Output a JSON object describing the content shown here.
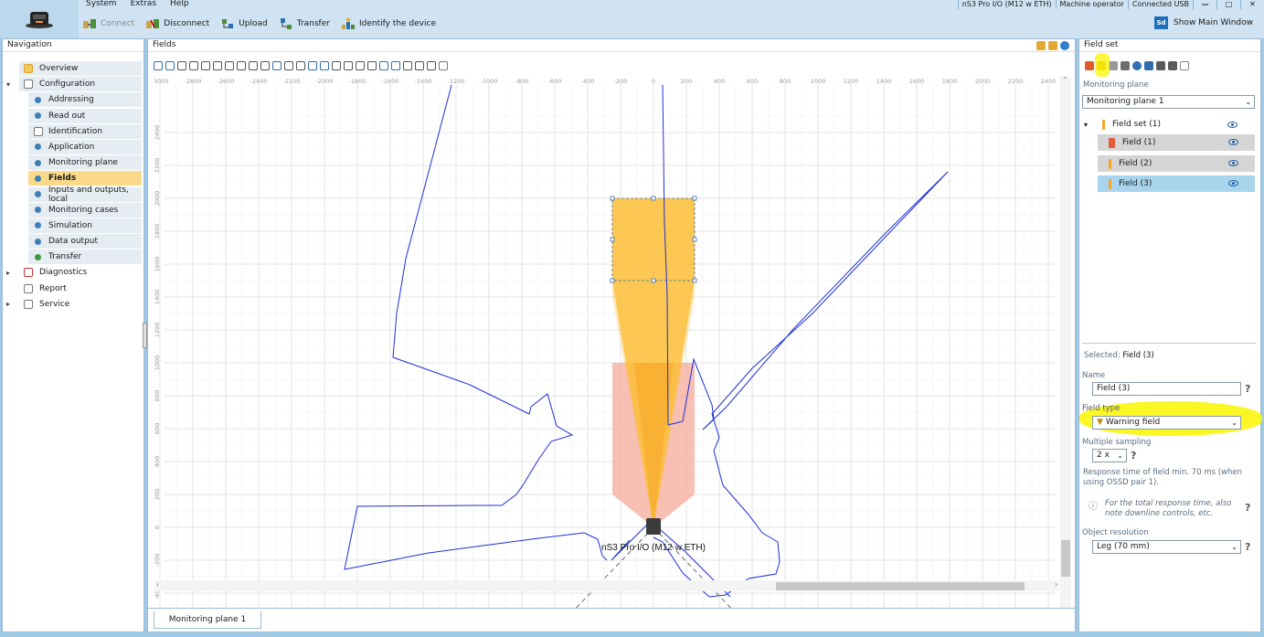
{
  "menu": {
    "items": [
      "System",
      "Extras",
      "Help"
    ]
  },
  "titlebar": {
    "device": "nS3 Pro I/O (M12 w ETH)",
    "role": "Machine operator",
    "connection": "Connected USB",
    "minimize": "—",
    "maximize": "□",
    "close": "✕"
  },
  "toolbar": {
    "connect": "Connect",
    "disconnect": "Disconnect",
    "upload": "Upload",
    "transfer": "Transfer",
    "identify": "Identify the device",
    "show_main_icon": "Sd",
    "show_main": "Show Main Window"
  },
  "navigation": {
    "title": "Navigation",
    "items": [
      {
        "label": "Overview",
        "level": 0,
        "icon": "overview-icon"
      },
      {
        "label": "Configuration",
        "level": 0,
        "icon": "configuration-icon",
        "expanded": true
      },
      {
        "label": "Addressing",
        "level": 1,
        "icon": "dot-icon"
      },
      {
        "label": "Read out",
        "level": 1,
        "icon": "dot-icon"
      },
      {
        "label": "Identification",
        "level": 1,
        "icon": "identification-icon"
      },
      {
        "label": "Application",
        "level": 1,
        "icon": "dot-icon"
      },
      {
        "label": "Monitoring plane",
        "level": 1,
        "icon": "dot-icon"
      },
      {
        "label": "Fields",
        "level": 1,
        "icon": "dot-icon",
        "active": true
      },
      {
        "label": "Inputs and outputs, local",
        "level": 1,
        "icon": "dot-icon"
      },
      {
        "label": "Monitoring cases",
        "level": 1,
        "icon": "dot-icon"
      },
      {
        "label": "Simulation",
        "level": 1,
        "icon": "dot-icon"
      },
      {
        "label": "Data output",
        "level": 1,
        "icon": "dot-icon"
      },
      {
        "label": "Transfer",
        "level": 1,
        "icon": "check-icon"
      },
      {
        "label": "Diagnostics",
        "level": 0,
        "icon": "diagnostics-icon",
        "collapsed": true
      },
      {
        "label": "Report",
        "level": 0,
        "icon": "report-icon"
      },
      {
        "label": "Service",
        "level": 0,
        "icon": "service-icon",
        "collapsed": true
      }
    ]
  },
  "fields_panel": {
    "title": "Fields",
    "device_label": "nS3 Pro I/O (M12 w ETH)",
    "x_ticks": [
      "-3000",
      "-2800",
      "-2600",
      "-2400",
      "-2200",
      "-2000",
      "-1800",
      "-1600",
      "-1400",
      "-1200",
      "-1000",
      "-800",
      "-600",
      "-400",
      "-200",
      "0",
      "200",
      "400",
      "600",
      "800",
      "1000",
      "1200",
      "1400",
      "1600",
      "1800",
      "2000",
      "2200",
      "2400"
    ],
    "y_ticks": [
      "2400",
      "2200",
      "2000",
      "1800",
      "1600",
      "1400",
      "1200",
      "1000",
      "800",
      "600",
      "400",
      "200",
      "0",
      "-200",
      "-400"
    ],
    "tab": "Monitoring plane 1",
    "colors": {
      "protective": "#f6a99a",
      "warning": "#fbbf3a",
      "field_dark": "#f7a622",
      "contour": "#1d2fd6",
      "grid": "#dcdcdc"
    }
  },
  "field_set_panel": {
    "title": "Field set",
    "monitoring_plane_label": "Monitoring plane",
    "monitoring_plane_value": "Monitoring plane 1",
    "tree": {
      "root": "Field set (1)",
      "children": [
        "Field (1)",
        "Field (2)",
        "Field (3)"
      ]
    },
    "selected_label": "Selected:",
    "selected_value": "Field (3)",
    "name_label": "Name",
    "name_value": "Field (3)",
    "field_type_label": "Field type",
    "field_type_value": "Warning field",
    "sampling_label": "Multiple sampling",
    "sampling_value": "2 x",
    "response_text": "Response time of field min. 70 ms (when using OSSD pair 1).",
    "info_text": "For the total response time, also note downline controls, etc.",
    "resolution_label": "Object resolution",
    "resolution_value": "Leg (70 mm)",
    "help": "?",
    "chevron": "⌄",
    "info_icon": "ⓘ"
  }
}
